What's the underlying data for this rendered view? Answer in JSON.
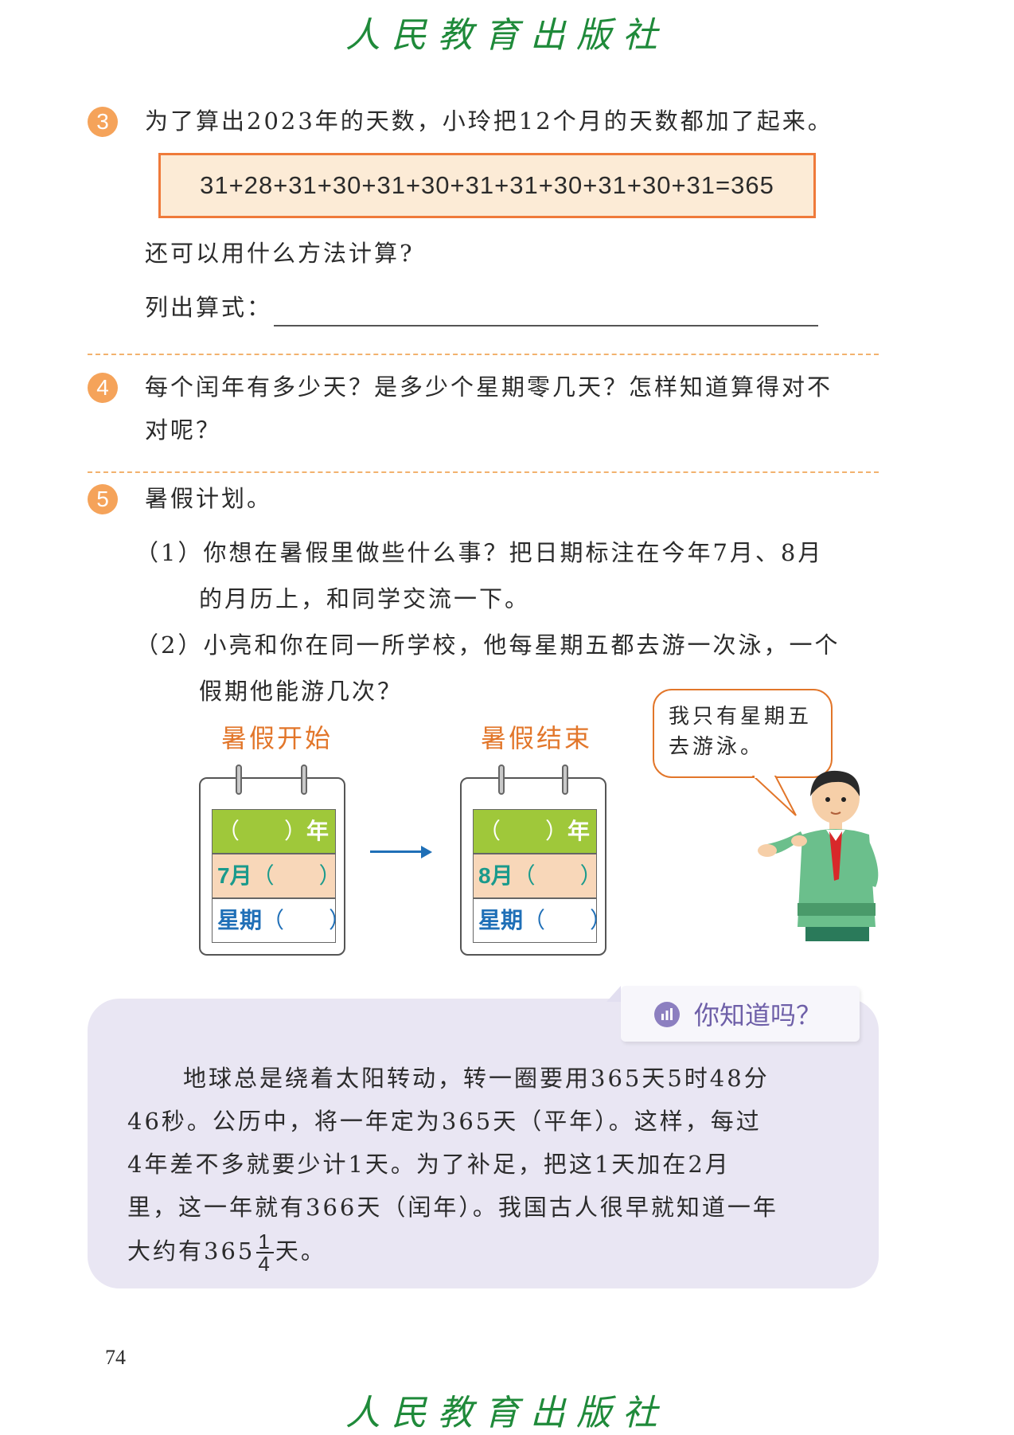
{
  "header": {
    "publisher": "人民教育出版社"
  },
  "q3": {
    "number": "3",
    "text": "为了算出2023年的天数，小玲把12个月的天数都加了起来。",
    "equation": "31+28+31+30+31+30+31+31+30+31+30+31=365",
    "question": "还可以用什么方法计算?",
    "formula_label": "列出算式："
  },
  "q4": {
    "number": "4",
    "line1": "每个闰年有多少天？是多少个星期零几天？怎样知道算得对不",
    "line2": "对呢？"
  },
  "q5": {
    "number": "5",
    "title": "暑假计划。",
    "p1_line1": "（1）你想在暑假里做些什么事？把日期标注在今年7月、8月",
    "p1_line2": "的月历上，和同学交流一下。",
    "p2_line1": "（2）小亮和你在同一所学校，他每星期五都去游一次泳，一个",
    "p2_line2": "假期他能游几次？"
  },
  "calendars": {
    "start_title": "暑假开始",
    "end_title": "暑假结束",
    "year_paren": "（　　）",
    "year_suffix": "年",
    "start_month": "7月",
    "end_month": "8月",
    "month_paren": "（　　）",
    "week_label": "星期",
    "week_paren": "（　　）"
  },
  "speech": {
    "line1": "我只有星期五",
    "line2": "去游泳。"
  },
  "info": {
    "title": "你知道吗？",
    "line1": "地球总是绕着太阳转动，转一圈要用365天5时48分",
    "line2": "46秒。公历中，将一年定为365天（平年）。这样，每过",
    "line3": "4年差不多就要少计1天。为了补足，把这1天加在2月",
    "line4": "里，这一年就有366天（闰年）。我国古人很早就知道一年",
    "line5_prefix": "大约有365",
    "fraction_num": "1",
    "fraction_den": "4",
    "line5_suffix": "天。"
  },
  "footer": {
    "page_number": "74",
    "publisher": "人民教育出版社"
  },
  "colors": {
    "accent_orange": "#ef7a3a",
    "number_circle": "#f5a35a",
    "publisher_green": "#1f8a3a",
    "info_purple": "#6e5fa8"
  }
}
